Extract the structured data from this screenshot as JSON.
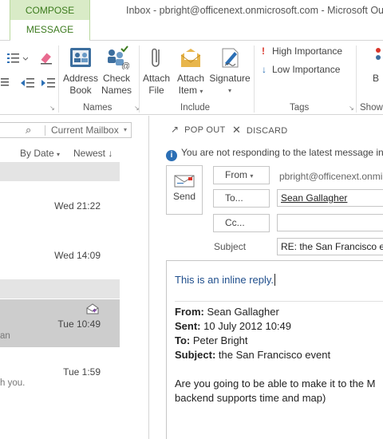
{
  "window": {
    "title": "Inbox - pbright@officenext.onmicrosoft.com - Microsoft Out",
    "contextual_tab": "COMPOSE TOOLS",
    "active_tab": "MESSAGE"
  },
  "ribbon": {
    "address_book": [
      "Address",
      "Book"
    ],
    "check_names": [
      "Check",
      "Names"
    ],
    "attach_file": [
      "Attach",
      "File"
    ],
    "attach_item": [
      "Attach",
      "Item"
    ],
    "signature": "Signature",
    "high_importance": "High Importance",
    "low_importance": "Low Importance",
    "partial_next": "B",
    "groups": {
      "names": "Names",
      "include": "Include",
      "tags": "Tags",
      "show": "Show"
    }
  },
  "mail_list": {
    "search_scope": "Current Mailbox",
    "sort_by": "By Date",
    "sort_order": "Newest",
    "messages": [
      {
        "time": "Wed 21:22"
      },
      {
        "time": "Wed 14:09"
      },
      {
        "time": "Tue 10:49",
        "preview": "an",
        "selected": true
      },
      {
        "time": "Tue 1:59",
        "preview": "h you."
      }
    ]
  },
  "compose": {
    "pop_out": "POP OUT",
    "discard": "DISCARD",
    "info_bar": "You are not responding to the latest message in",
    "send": "Send",
    "from_button": "From",
    "from_address": "pbright@officenext.onmi",
    "to_button": "To...",
    "to_value": "Sean Gallagher",
    "cc_button": "Cc...",
    "cc_value": "",
    "subject_label": "Subject",
    "subject_value": "RE: the San Francisco eve",
    "body": {
      "inline_reply": "This is an inline reply.",
      "from_label": "From:",
      "from_value": "Sean Gallagher",
      "sent_label": "Sent:",
      "sent_value": "10 July 2012 10:49",
      "to_label": "To:",
      "to_value": "Peter Bright",
      "subject_label": "Subject:",
      "subject_value": "the San Francisco event",
      "line1": "Are you going to be able to make it to the M",
      "line2": "backend supports time and map)"
    }
  },
  "colors": {
    "accent_green": "#3c7b1e",
    "compose_tab_bg": "#d9ebc7",
    "info_blue": "#2b6fb5",
    "reply_blue": "#1f4e8c"
  }
}
